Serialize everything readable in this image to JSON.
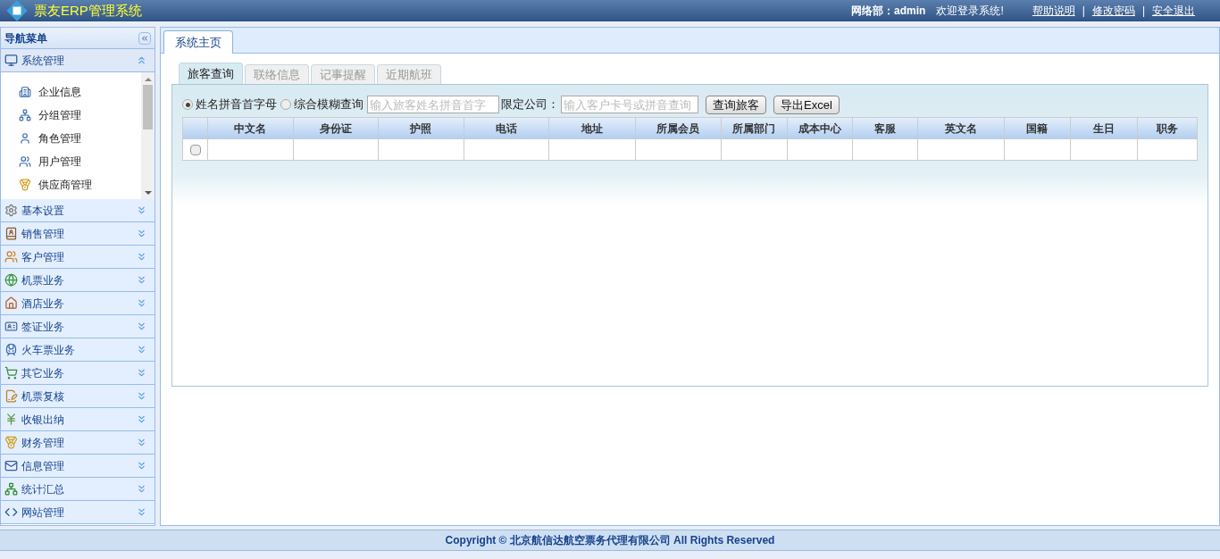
{
  "header": {
    "title": "票友ERP管理系统",
    "user": "网络部：admin",
    "welcome": "欢迎登录系统!",
    "links": [
      "帮助说明",
      "修改密码",
      "安全退出"
    ],
    "separator": "|"
  },
  "sidebar": {
    "title": "导航菜单",
    "sections": [
      {
        "label": "系统管理",
        "expanded": true,
        "items": [
          "企业信息",
          "分组管理",
          "角色管理",
          "用户管理",
          "供应商管理"
        ]
      },
      {
        "label": "基本设置",
        "expanded": false
      },
      {
        "label": "销售管理",
        "expanded": false
      },
      {
        "label": "客户管理",
        "expanded": false
      },
      {
        "label": "机票业务",
        "expanded": false
      },
      {
        "label": "酒店业务",
        "expanded": false
      },
      {
        "label": "签证业务",
        "expanded": false
      },
      {
        "label": "火车票业务",
        "expanded": false
      },
      {
        "label": "其它业务",
        "expanded": false
      },
      {
        "label": "机票复核",
        "expanded": false
      },
      {
        "label": "收银出纳",
        "expanded": false
      },
      {
        "label": "财务管理",
        "expanded": false
      },
      {
        "label": "信息管理",
        "expanded": false
      },
      {
        "label": "统计汇总",
        "expanded": false
      },
      {
        "label": "网站管理",
        "expanded": false
      }
    ]
  },
  "main_tabs": [
    {
      "label": "系统主页",
      "selected": true
    }
  ],
  "sub_tabs": [
    {
      "label": "旅客查询",
      "selected": true
    },
    {
      "label": "联络信息",
      "selected": false
    },
    {
      "label": "记事提醒",
      "selected": false
    },
    {
      "label": "近期航班",
      "selected": false
    }
  ],
  "search": {
    "modes": [
      {
        "label": "姓名拼音首字母",
        "selected": true
      },
      {
        "label": "综合模糊查询",
        "selected": false
      }
    ],
    "name_field": {
      "placeholder": "输入旅客姓名拼音首字"
    },
    "company_label": "限定公司：",
    "company_field": {
      "placeholder": "输入客户卡号或拼音查询"
    },
    "buttons": [
      "查询旅客",
      "导出Excel"
    ]
  },
  "table": {
    "columns": [
      "中文名",
      "身份证",
      "护照",
      "电话",
      "地址",
      "所属会员",
      "所属部门",
      "成本中心",
      "客服",
      "英文名",
      "国籍",
      "生日",
      "职务"
    ],
    "rows": [
      {
        "checked": false
      }
    ]
  },
  "footer": "Copyright © 北京航信达航空票务代理有限公司 All Rights Reserved"
}
